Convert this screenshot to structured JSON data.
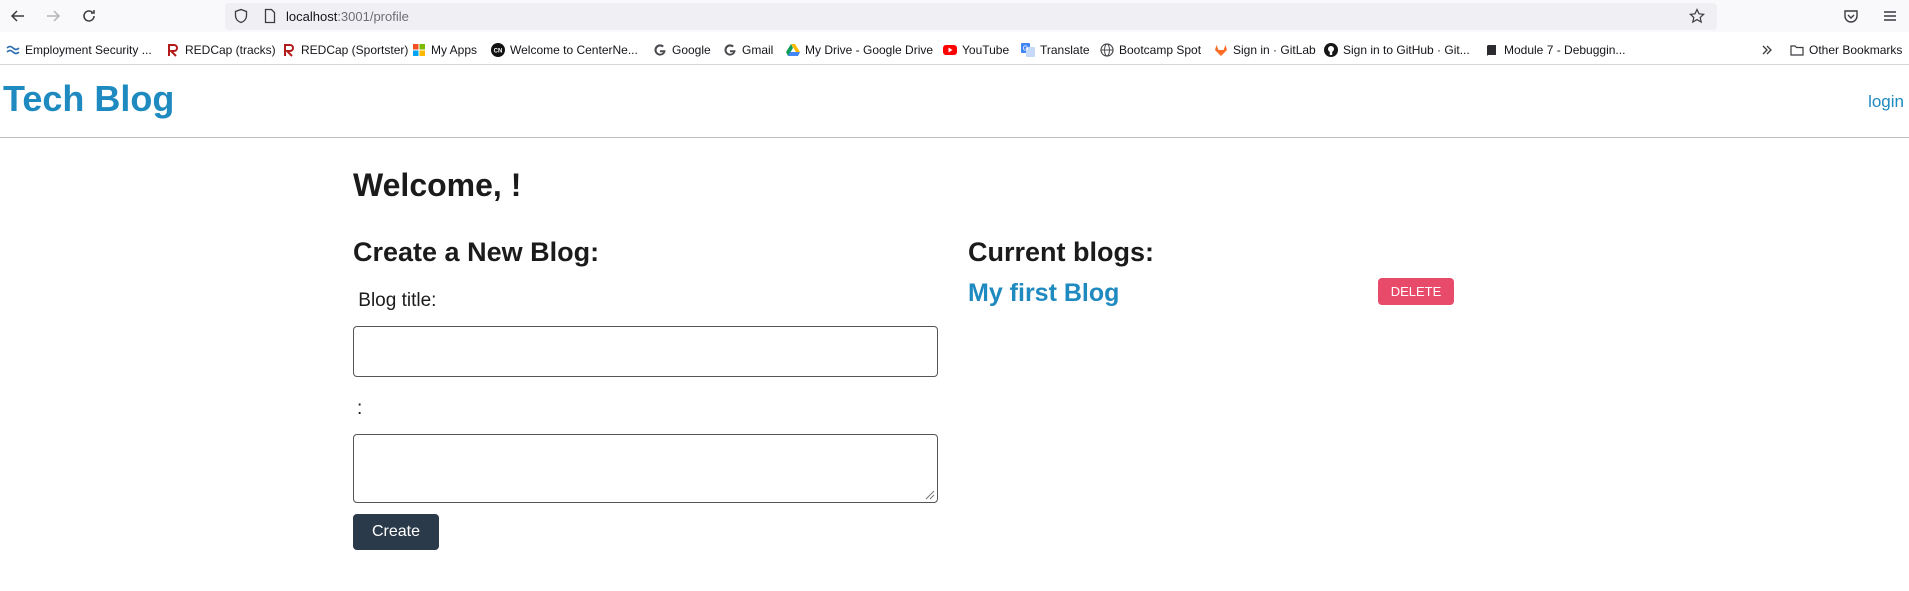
{
  "browser": {
    "url_host": "localhost",
    "url_path": ":3001/profile",
    "bookmarks": [
      {
        "label": "Employment Security ...",
        "icon": "wave-icon"
      },
      {
        "label": "REDCap (tracks)",
        "icon": "redcap-icon"
      },
      {
        "label": "REDCap (Sportster)",
        "icon": "redcap-icon"
      },
      {
        "label": "My Apps",
        "icon": "apps-grid-icon"
      },
      {
        "label": "Welcome to CenterNe...",
        "icon": "cn-icon"
      },
      {
        "label": "Google",
        "icon": "google-icon"
      },
      {
        "label": "Gmail",
        "icon": "google-icon"
      },
      {
        "label": "My Drive - Google Drive",
        "icon": "drive-icon"
      },
      {
        "label": "YouTube",
        "icon": "youtube-icon"
      },
      {
        "label": "Translate",
        "icon": "translate-icon"
      },
      {
        "label": "Bootcamp Spot",
        "icon": "globe-icon"
      },
      {
        "label": "Sign in · GitLab",
        "icon": "gitlab-icon"
      },
      {
        "label": "Sign in to GitHub · Git...",
        "icon": "github-icon"
      },
      {
        "label": "Module 7 - Debuggin...",
        "icon": "book-icon"
      }
    ],
    "other_bookmarks": "Other Bookmarks"
  },
  "header": {
    "title": "Tech Blog",
    "login_label": "login"
  },
  "main": {
    "welcome": "Welcome, !",
    "create_heading": "Create a New Blog:",
    "title_label": " Blog title:",
    "title_value": "",
    "content_label": ":",
    "content_value": "",
    "create_button": "Create",
    "current_heading": "Current blogs:",
    "blogs": [
      {
        "title": "My first Blog",
        "delete_label": "DELETE"
      }
    ]
  },
  "colors": {
    "brand": "#1f8ac0",
    "delete": "#e84a6a",
    "create_button": "#2b3a4a"
  }
}
